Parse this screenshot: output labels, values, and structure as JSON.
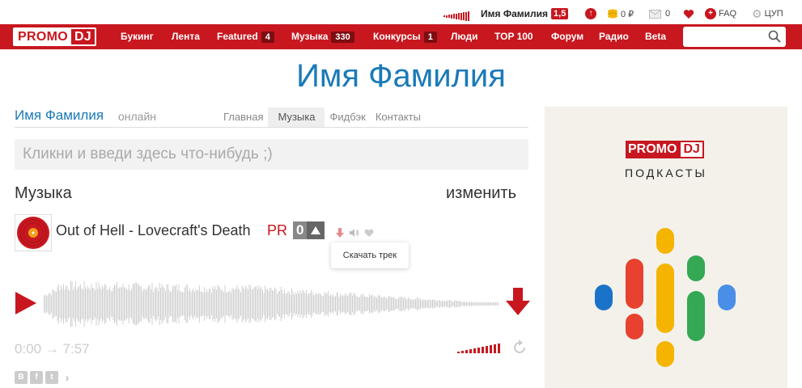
{
  "userbar": {
    "username": "Имя Фамилия",
    "rating": "1,5",
    "coins": "0 ₽",
    "messages": "0",
    "faq": "FAQ",
    "cup": "ЦУП"
  },
  "nav": {
    "logo_left": "PROMO",
    "logo_right": "DJ",
    "items": [
      {
        "label": "Букинг",
        "badge": ""
      },
      {
        "label": "Лента",
        "badge": ""
      },
      {
        "label": "Featured",
        "badge": "4"
      },
      {
        "label": "Музыка",
        "badge": "330"
      },
      {
        "label": "Конкурсы",
        "badge": "1"
      },
      {
        "label": "Люди",
        "badge": ""
      },
      {
        "label": "TOP 100",
        "badge": ""
      },
      {
        "label": "Форум",
        "badge": ""
      },
      {
        "label": "Радио",
        "badge": ""
      },
      {
        "label": "Beta",
        "badge": ""
      }
    ],
    "search_placeholder": ""
  },
  "page": {
    "title": "Имя Фамилия",
    "user_name": "Имя Фамилия",
    "status": "онлайн",
    "tabs": [
      "Главная",
      "Музыка",
      "Фидбэк",
      "Контакты"
    ],
    "active_tab": "Музыка",
    "post_placeholder": "Кликни и введи здесь что-нибудь ;)"
  },
  "music": {
    "section_title": "Музыка",
    "edit_label": "изменить",
    "track_title": "Out of Hell - Lovecraft's Death",
    "pr_label": "PR",
    "rating": "0",
    "tooltip": "Скачать трек",
    "time": "0:00 → 7:57",
    "volume_level": 1.0,
    "social": [
      "В",
      "f",
      "t"
    ]
  },
  "ad": {
    "logo_left": "PROMO",
    "logo_right": "DJ",
    "subtitle": "ПОДКАСТЫ"
  },
  "colors": {
    "brand_red": "#c8171f",
    "link_blue": "#1a7ab8"
  }
}
